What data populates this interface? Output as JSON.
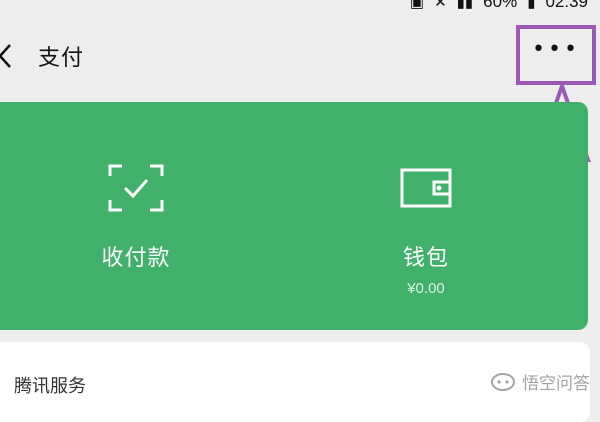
{
  "status_bar": {
    "battery_percent": "60%",
    "time": "02:39"
  },
  "header": {
    "title": "支付",
    "back_icon": "chevron-left-icon",
    "more_icon": "more-icon"
  },
  "card": {
    "color": "#41b06a",
    "items": [
      {
        "label": "收付款",
        "icon": "scan-check-icon"
      },
      {
        "label": "钱包",
        "sub": "¥0.00",
        "icon": "wallet-icon"
      }
    ]
  },
  "services": {
    "title": "腾讯服务"
  },
  "annotation": {
    "color": "#9b59b6"
  },
  "watermark": {
    "text": "悟空问答"
  }
}
